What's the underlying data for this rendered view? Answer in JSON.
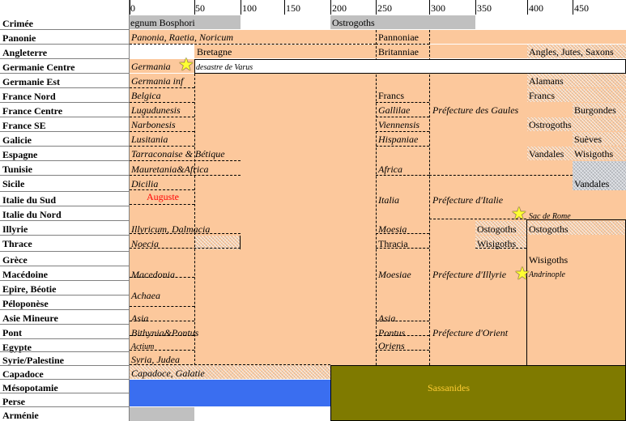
{
  "axis": {
    "ticks": [
      "0",
      "50",
      "100",
      "150",
      "200",
      "250",
      "300",
      "350",
      "400",
      "450"
    ]
  },
  "rows": [
    "Crimée",
    "Panonie",
    "Angleterre",
    "Germanie Centre",
    "Germanie Est",
    "France Nord",
    "France Centre",
    "France SE",
    "Galicie",
    "Espagne",
    "Tunisie",
    "Sicile",
    "Italie du Sud",
    "Italie du Nord",
    "Illyrie",
    "Thrace",
    "Grèce",
    "Macédoine",
    "Epire, Béotie",
    "Péloponèse",
    "Asie Mineure",
    "Pont",
    "Egypte",
    "Syrie/Palestine",
    "Capadoce",
    "Mésopotamie",
    "Perse",
    "Arménie"
  ],
  "cells": {
    "regnum_bosphori": "egnum Bosphori",
    "ostrogoths_crimee": "Ostrogoths",
    "panonia": "Panonia, Raetia, Noricum",
    "pannoniae": "Pannoniae",
    "bretagne": "Bretagne",
    "britanniae": "Britanniae",
    "angles": "Angles, Jutes, Saxons",
    "germania": "Germania",
    "varus": "desastre de Varus",
    "germania_inf": "Germania inf",
    "alamans": "Alamans",
    "belgica": "Belgica",
    "francs1": "Francs",
    "francs2": "Francs",
    "lugudunesis": "Lugudunesis",
    "gallilae": "Gallilae",
    "pref_gaules": "Préfecture des Gaules",
    "burgondes": "Burgondes",
    "narbonesis": "Narbonesis",
    "viennensis": "Viennensis",
    "ostrogoths_fse": "Ostrogoths",
    "lusitania": "Lusitania",
    "hispaniae": "Hispaniae",
    "sueves": "Suèves",
    "tarraconaise": "Tarraconaise & Bétique",
    "vandales_esp": "Vandales",
    "wisigoths_esp": "Wisigoths",
    "mauretania": "Mauretania&Africa",
    "africa": "Africa",
    "dicilia": "Dicilia",
    "vandales_sic": "Vandales",
    "auguste": "Auguste",
    "italia": "Italia",
    "pref_italie": "Préfecture d'Italie",
    "sac_rome": "Sac de Rome",
    "illyricum": "Illyricum, Dalmacia",
    "moesia": "Moesia",
    "ostogoths1": "Ostogoths",
    "ostogoths2": "Ostogoths",
    "noecia": "Noecia",
    "thracia": "Thracia",
    "wisigoths_thr": "Wisigoths",
    "wisigoths_gr": "Wisigoths",
    "macedonia": "Macedonia",
    "moesiae": "Moesiae",
    "pref_illyrie": "Préfecture d'Illyrie",
    "andrinople": "Andrinople",
    "achaea": "Achaea",
    "asia": "Asia",
    "asia2": "Asia",
    "bithynia": "Bithynia&Pontus",
    "pontus": "Pontus",
    "pref_orient": "Préfecture d'Orient",
    "actium": "Actium",
    "oriens": "Oriens",
    "syria": "Syria, Judea",
    "capadoce": "Capadoce, Galatie",
    "sassanides": "Sassanides"
  },
  "colors": {
    "roman": "#fcc89c",
    "neutral": "#c0c0c0",
    "parthian": "#3a6ef0",
    "sassanid": "#7f7a00",
    "sassanid_text": "#ffcc33",
    "auguste_text": "#ff0000",
    "star": "#ffff33"
  }
}
